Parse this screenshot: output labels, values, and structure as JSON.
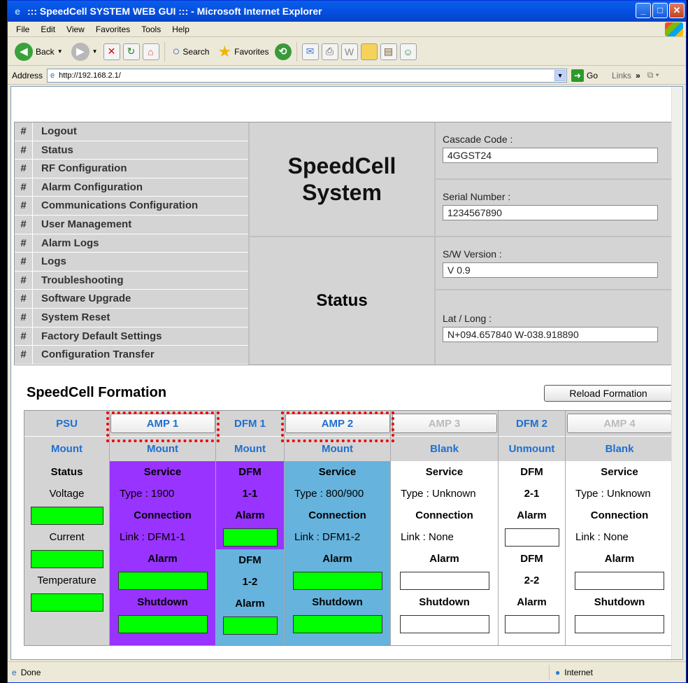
{
  "window": {
    "title": "::: SpeedCell SYSTEM WEB GUI ::: - Microsoft Internet Explorer",
    "menu": [
      "File",
      "Edit",
      "View",
      "Favorites",
      "Tools",
      "Help"
    ],
    "toolbar": {
      "back": "Back",
      "search": "Search",
      "favorites": "Favorites"
    },
    "address_label": "Address",
    "url": "http://192.168.2.1/",
    "go_label": "Go",
    "links_label": "Links",
    "status_text": "Done",
    "zone_text": "Internet"
  },
  "nav": {
    "items": [
      "Logout",
      "Status",
      "RF Configuration",
      "Alarm Configuration",
      "Communications Configuration",
      "User Management",
      "Alarm Logs",
      "Logs",
      "Troubleshooting",
      "Software Upgrade",
      "System Reset",
      "Factory Default Settings",
      "Configuration Transfer"
    ],
    "marker": "#"
  },
  "brand": {
    "line1": "SpeedCell",
    "line2": "System"
  },
  "status_title": "Status",
  "info": {
    "cascade_label": "Cascade Code :",
    "cascade_value": "4GGST24",
    "serial_label": "Serial Number :",
    "serial_value": "1234567890",
    "sw_label": "S/W Version :",
    "sw_value": "V 0.9",
    "latlong_label": "Lat / Long :",
    "latlong_value": "N+094.657840 W-038.918890"
  },
  "formation": {
    "title": "SpeedCell Formation",
    "reload_label": "Reload Formation",
    "psu": {
      "header": "PSU",
      "mount": "Mount",
      "status": "Status",
      "voltage": "Voltage",
      "current": "Current",
      "temperature": "Temperature"
    },
    "amp1": {
      "header": "AMP 1",
      "mount": "Mount",
      "service": "Service",
      "type": "Type : 1900",
      "connection": "Connection",
      "link": "Link : DFM1-1",
      "alarm": "Alarm",
      "shutdown": "Shutdown"
    },
    "dfm1": {
      "header": "DFM 1",
      "mount": "Mount",
      "dfm_a": "DFM",
      "id_a": "1-1",
      "alarm_a": "Alarm",
      "dfm_b": "DFM",
      "id_b": "1-2",
      "alarm_b": "Alarm"
    },
    "amp2": {
      "header": "AMP 2",
      "mount": "Mount",
      "service": "Service",
      "type": "Type : 800/900",
      "connection": "Connection",
      "link": "Link : DFM1-2",
      "alarm": "Alarm",
      "shutdown": "Shutdown"
    },
    "amp3": {
      "header": "AMP 3",
      "mount": "Blank",
      "service": "Service",
      "type": "Type : Unknown",
      "connection": "Connection",
      "link": "Link : None",
      "alarm": "Alarm",
      "shutdown": "Shutdown"
    },
    "dfm2": {
      "header": "DFM 2",
      "mount": "Unmount",
      "dfm_a": "DFM",
      "id_a": "2-1",
      "alarm_a": "Alarm",
      "dfm_b": "DFM",
      "id_b": "2-2",
      "alarm_b": "Alarm"
    },
    "amp4": {
      "header": "AMP 4",
      "mount": "Blank",
      "service": "Service",
      "type": "Type : Unknown",
      "connection": "Connection",
      "link": "Link : None",
      "alarm": "Alarm",
      "shutdown": "Shutdown"
    }
  },
  "colors": {
    "amp1_bg": "#9933ff",
    "amp2_bg": "#66b3dd",
    "ok_green": "#00ff00",
    "link_blue": "#1f6fcf"
  }
}
